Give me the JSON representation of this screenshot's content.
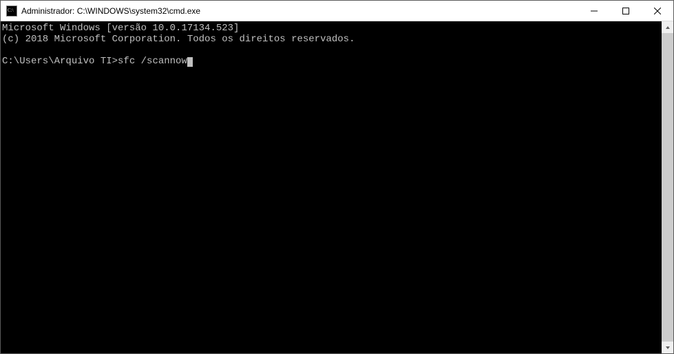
{
  "window": {
    "title": "Administrador: C:\\WINDOWS\\system32\\cmd.exe"
  },
  "terminal": {
    "line1": "Microsoft Windows [versão 10.0.17134.523]",
    "line2": "(c) 2018 Microsoft Corporation. Todos os direitos reservados.",
    "blank": "",
    "prompt": "C:\\Users\\Arquivo TI>",
    "command": "sfc /scannow"
  }
}
